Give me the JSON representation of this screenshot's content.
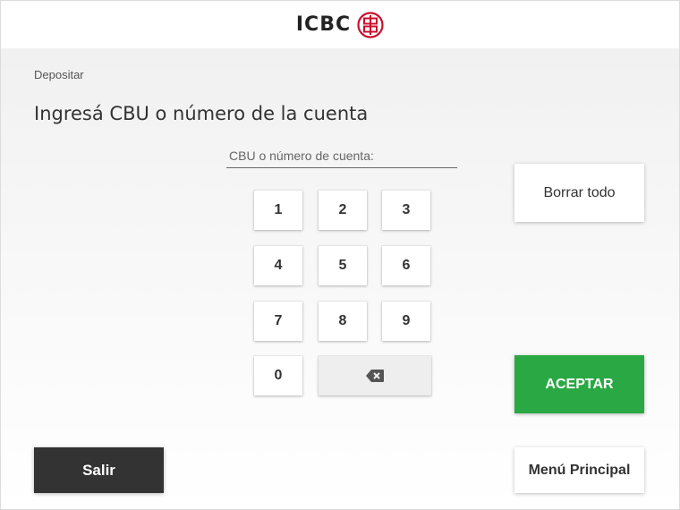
{
  "header": {
    "brand": "ICBC",
    "brand_color": "#c8102e"
  },
  "breadcrumb": "Depositar",
  "title": "Ingresá CBU o número de la cuenta",
  "account_field": {
    "placeholder": "CBU o número de cuenta:",
    "value": ""
  },
  "keypad": {
    "keys": [
      "1",
      "2",
      "3",
      "4",
      "5",
      "6",
      "7",
      "8",
      "9",
      "0"
    ],
    "backspace_icon": "backspace-icon"
  },
  "actions": {
    "clear_all": "Borrar todo",
    "accept": "ACEPTAR",
    "exit": "Salir",
    "main_menu": "Menú Principal"
  },
  "colors": {
    "accept": "#2aa844",
    "exit": "#333333",
    "backspace_key": "#eeeeee"
  }
}
